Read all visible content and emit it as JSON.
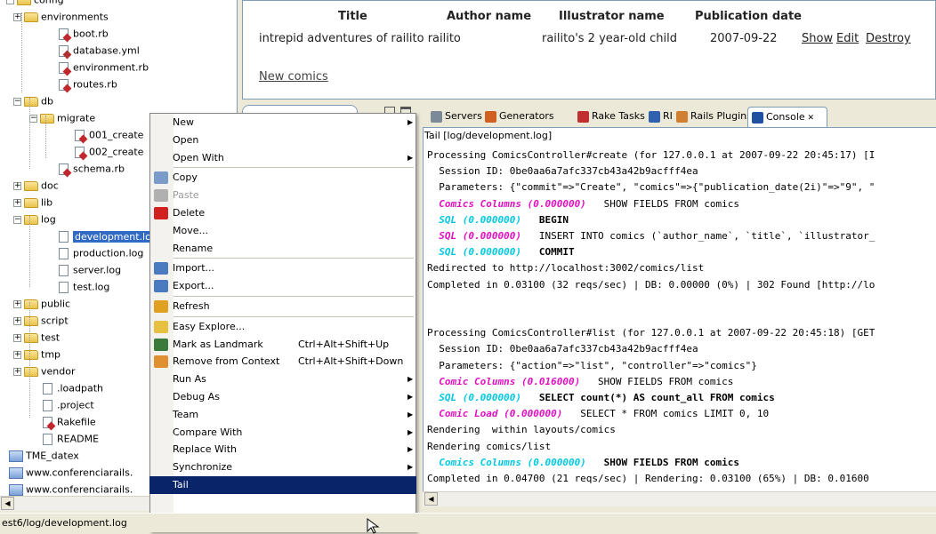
{
  "tree": {
    "items": [
      {
        "label": "config",
        "type": "folder"
      },
      {
        "label": "environments",
        "type": "folder"
      },
      {
        "label": "boot.rb",
        "type": "rb"
      },
      {
        "label": "database.yml",
        "type": "yml"
      },
      {
        "label": "environment.rb",
        "type": "rb"
      },
      {
        "label": "routes.rb",
        "type": "rb"
      },
      {
        "label": "db",
        "type": "folder"
      },
      {
        "label": "migrate",
        "type": "folder"
      },
      {
        "label": "001_create",
        "type": "rb"
      },
      {
        "label": "002_create",
        "type": "rb"
      },
      {
        "label": "schema.rb",
        "type": "rb"
      },
      {
        "label": "doc",
        "type": "folder"
      },
      {
        "label": "lib",
        "type": "folder"
      },
      {
        "label": "log",
        "type": "folder"
      },
      {
        "label": "development.lo",
        "type": "file"
      },
      {
        "label": "production.log",
        "type": "file"
      },
      {
        "label": "server.log",
        "type": "file"
      },
      {
        "label": "test.log",
        "type": "file"
      },
      {
        "label": "public",
        "type": "folder"
      },
      {
        "label": "script",
        "type": "folder"
      },
      {
        "label": "test",
        "type": "folder"
      },
      {
        "label": "tmp",
        "type": "folder"
      },
      {
        "label": "vendor",
        "type": "folder"
      },
      {
        "label": ".loadpath",
        "type": "file"
      },
      {
        "label": ".project",
        "type": "file"
      },
      {
        "label": "Rakefile",
        "type": "rb"
      },
      {
        "label": "README",
        "type": "file"
      },
      {
        "label": "TME_datex",
        "type": "proj"
      },
      {
        "label": "www.conferenciarails.",
        "type": "proj"
      },
      {
        "label": "www.conferenciarails.",
        "type": "proj"
      }
    ]
  },
  "status_bar": {
    "text": "est6/log/development.log"
  },
  "browser": {
    "headers": {
      "title": "Title",
      "author": "Author name",
      "illustrator": "Illustrator name",
      "date": "Publication date"
    },
    "row": {
      "title": "intrepid adventures of railito railito",
      "author": "railito's 2 year-old child",
      "date": "2007-09-22",
      "show": "Show",
      "edit": "Edit",
      "destroy": "Destroy"
    },
    "new_link": "New comics"
  },
  "console_tabs": [
    {
      "label": "Servers",
      "icon": "servers-icon"
    },
    {
      "label": "Generators",
      "icon": "generators-icon"
    },
    {
      "label": "Rake Tasks",
      "icon": "rake-icon"
    },
    {
      "label": "RI",
      "icon": "ri-icon"
    },
    {
      "label": "Rails Plugins",
      "icon": "plugins-icon"
    },
    {
      "label": "Console",
      "icon": "console-icon"
    }
  ],
  "console": {
    "title": "Tail [log/development.log]",
    "lines": [
      {
        "parts": [
          {
            "t": "Processing ComicsController#create (for 127.0.0.1 at 2007-09-22 20:45:17) [I",
            "c": ""
          }
        ]
      },
      {
        "parts": [
          {
            "t": "  Session ID: 0be0aa6a7afc337cb43a42b9acfff4ea",
            "c": ""
          }
        ]
      },
      {
        "parts": [
          {
            "t": "  Parameters: {\"commit\"=>\"Create\", \"comics\"=>{\"publication_date(2i)\"=>\"9\", \"",
            "c": ""
          }
        ]
      },
      {
        "parts": [
          {
            "t": "  Comics Columns (0.000000)",
            "c": "mag"
          },
          {
            "t": "   SHOW FIELDS FROM comics",
            "c": ""
          }
        ]
      },
      {
        "parts": [
          {
            "t": "  SQL (0.000000)",
            "c": "cya"
          },
          {
            "t": "   BEGIN",
            "c": "bold"
          }
        ]
      },
      {
        "parts": [
          {
            "t": "  SQL (0.000000)",
            "c": "mag"
          },
          {
            "t": "   INSERT INTO comics (`author_name`, `title`, `illustrator_",
            "c": ""
          }
        ]
      },
      {
        "parts": [
          {
            "t": "  SQL (0.000000)",
            "c": "cya"
          },
          {
            "t": "   COMMIT",
            "c": "bold"
          }
        ]
      },
      {
        "parts": [
          {
            "t": "Redirected to http://localhost:3002/comics/list",
            "c": ""
          }
        ]
      },
      {
        "parts": [
          {
            "t": "Completed in 0.03100 (32 reqs/sec) | DB: 0.00000 (0%) | 302 Found [http://lo",
            "c": ""
          }
        ]
      },
      {
        "parts": [
          {
            "t": "",
            "c": ""
          }
        ]
      },
      {
        "parts": [
          {
            "t": "",
            "c": ""
          }
        ]
      },
      {
        "parts": [
          {
            "t": "Processing ComicsController#list (for 127.0.0.1 at 2007-09-22 20:45:18) [GET",
            "c": ""
          }
        ]
      },
      {
        "parts": [
          {
            "t": "  Session ID: 0be0aa6a7afc337cb43a42b9acfff4ea",
            "c": ""
          }
        ]
      },
      {
        "parts": [
          {
            "t": "  Parameters: {\"action\"=>\"list\", \"controller\"=>\"comics\"}",
            "c": ""
          }
        ]
      },
      {
        "parts": [
          {
            "t": "  Comic Columns (0.016000)",
            "c": "mag"
          },
          {
            "t": "   SHOW FIELDS FROM comics",
            "c": ""
          }
        ]
      },
      {
        "parts": [
          {
            "t": "  SQL (0.000000)",
            "c": "cya"
          },
          {
            "t": "   SELECT count(*) AS count_all FROM comics",
            "c": "bold"
          }
        ]
      },
      {
        "parts": [
          {
            "t": "  Comic Load (0.000000)",
            "c": "mag"
          },
          {
            "t": "   SELECT * FROM comics LIMIT 0, 10",
            "c": ""
          }
        ]
      },
      {
        "parts": [
          {
            "t": "Rendering  within layouts/comics",
            "c": ""
          }
        ]
      },
      {
        "parts": [
          {
            "t": "Rendering comics/list",
            "c": ""
          }
        ]
      },
      {
        "parts": [
          {
            "t": "  Comics Columns (0.000000)",
            "c": "cya"
          },
          {
            "t": "   SHOW FIELDS FROM comics",
            "c": "bold"
          }
        ]
      },
      {
        "parts": [
          {
            "t": "Completed in 0.04700 (21 reqs/sec) | Rendering: 0.03100 (65%) | DB: 0.01600",
            "c": ""
          }
        ]
      }
    ]
  },
  "menu": {
    "items": [
      {
        "label": "New",
        "submenu": true
      },
      {
        "label": "Open"
      },
      {
        "label": "Open With",
        "submenu": true
      },
      {
        "sep": true
      },
      {
        "label": "Copy",
        "icon": "copy-icon"
      },
      {
        "label": "Paste",
        "icon": "paste-icon",
        "disabled": true
      },
      {
        "label": "Delete",
        "icon": "delete-icon"
      },
      {
        "label": "Move..."
      },
      {
        "label": "Rename"
      },
      {
        "sep": true
      },
      {
        "label": "Import...",
        "icon": "import-icon"
      },
      {
        "label": "Export...",
        "icon": "export-icon"
      },
      {
        "sep": true
      },
      {
        "label": "Refresh",
        "icon": "refresh-icon"
      },
      {
        "sep": true
      },
      {
        "label": "Easy Explore...",
        "icon": "explore-icon"
      },
      {
        "label": "Mark as Landmark",
        "icon": "landmark-icon",
        "accel": "Ctrl+Alt+Shift+Up"
      },
      {
        "label": "Remove from Context",
        "icon": "remove-context-icon",
        "accel": "Ctrl+Alt+Shift+Down"
      },
      {
        "label": "Run As",
        "submenu": true
      },
      {
        "label": "Debug As",
        "submenu": true
      },
      {
        "label": "Team",
        "submenu": true
      },
      {
        "label": "Compare With",
        "submenu": true
      },
      {
        "label": "Replace With",
        "submenu": true
      },
      {
        "label": "Synchronize",
        "submenu": true
      },
      {
        "label": "Tail",
        "highlighted": true
      }
    ]
  }
}
